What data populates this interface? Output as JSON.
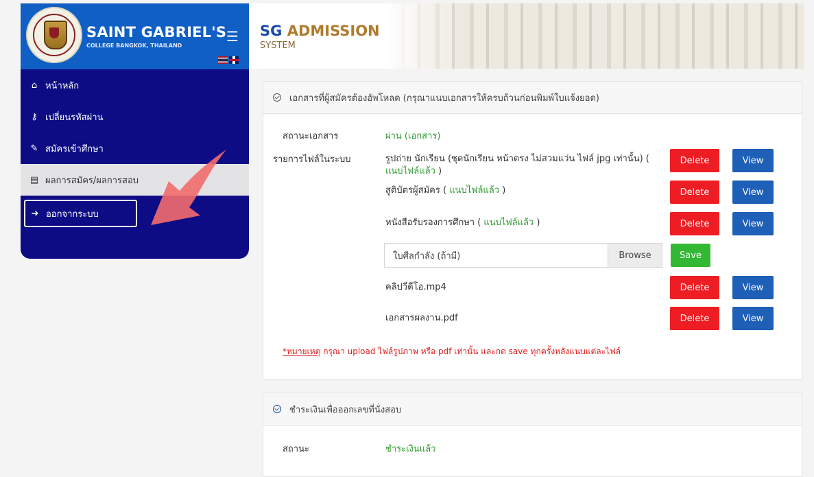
{
  "brand": {
    "name": "SAINT GABRIEL'S",
    "subtitle": "COLLEGE BANGKOK, THAILAND",
    "seal_text": "Saint Gabriel's College"
  },
  "header": {
    "title_sg": "SG",
    "title_admission": "ADMISSION",
    "subtitle": "SYSTEM"
  },
  "menu": [
    {
      "label": "หน้าหลัก",
      "icon": "home-icon"
    },
    {
      "label": "เปลี่ยนรหัสผ่าน",
      "icon": "key-icon"
    },
    {
      "label": "สมัครเข้าศึกษา",
      "icon": "edit-icon"
    },
    {
      "label": "ผลการสมัคร/ผลการสอบ",
      "icon": "list-icon"
    },
    {
      "label": "ออกจากระบบ",
      "icon": "sign-out-icon"
    }
  ],
  "documents": {
    "title": "เอกสารที่ผู้สมัครต้องอัพโหลด (กรุณาแนบเอกสารให้ครบถ้วนก่อนพิมพ์ใบแจ้งยอด)",
    "status_label": "สถานะเอกสาร",
    "status_value": "ผ่าน (เอกสาร)",
    "files_label": "รายการไฟล์ในระบบ",
    "files": [
      {
        "name": "รูปถ่าย นักเรียน (ชุดนักเรียน หน้าตรง ไม่สวมแว่น ไฟล์ jpg เท่านั้น) (",
        "attached": " แนบไฟล์แล้ว",
        "suffix": " )"
      },
      {
        "name": "สูติบัตรผู้สมัคร (",
        "attached": " แนบไฟล์แล้ว",
        "suffix": " )"
      },
      {
        "name": "หนังสือรับรองการศึกษา (",
        "attached": " แนบไฟล์แล้ว",
        "suffix": " )"
      },
      {
        "name": "คลิปวีดีโอ.mp4"
      },
      {
        "name": "เอกสารผลงาน.pdf"
      }
    ],
    "upload_placeholder": "ใบศีลกำลัง (ถ้ามี)",
    "browse_label": "Browse",
    "save_label": "Save",
    "delete_label": "Delete",
    "view_label": "View",
    "note_prefix": "*หมายเหตุ",
    "note_text": " กรุณา upload ไฟล์รูปภาพ หรือ pdf เท่านั้น และกด save ทุกครั้งหลังแนบแต่ละไฟล์"
  },
  "payment": {
    "title": "ชำระเงินเพื่อออกเลขที่นั่งสอบ",
    "status_label": "สถานะ",
    "status_value": "ชำระเงินแล้ว"
  },
  "colors": {
    "sidebar": "#0d0c85",
    "brand_bar": "#0f5fc4",
    "delete": "#ee1d24",
    "view": "#1e5fb8",
    "save": "#33b833",
    "success_text": "#2e9a2e",
    "note_text": "#e01b1b",
    "arrow": "#f26b6b"
  }
}
